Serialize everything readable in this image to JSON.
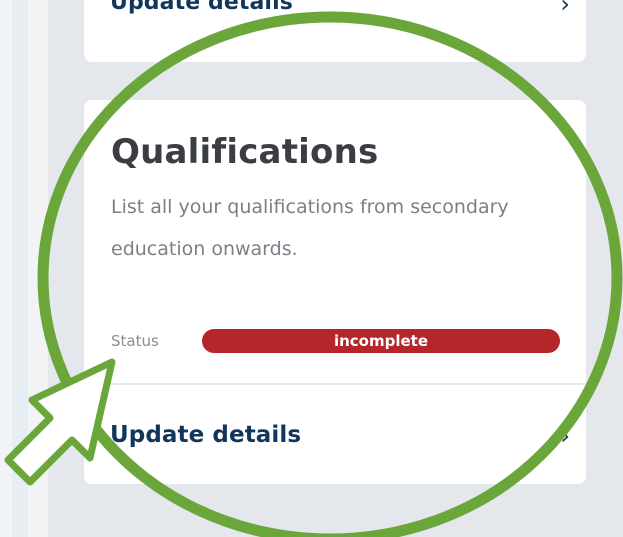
{
  "top_card": {
    "update_label": "Update details",
    "chevron": "›"
  },
  "qualifications_card": {
    "title": "Qualifications",
    "description": "List all your qualifications from secondary education onwards.",
    "status_label": "Status",
    "status_value": "incomplete",
    "update_label": "Update details",
    "chevron": "›"
  },
  "colors": {
    "background": "#e4e7ec",
    "card": "#ffffff",
    "primary_text": "#12355a",
    "status_incomplete": "#b4262a",
    "highlight_circle": "#6aa63a"
  },
  "icons": {
    "chevron": "chevron-right-icon",
    "pointer": "pointer-arrow-icon"
  }
}
